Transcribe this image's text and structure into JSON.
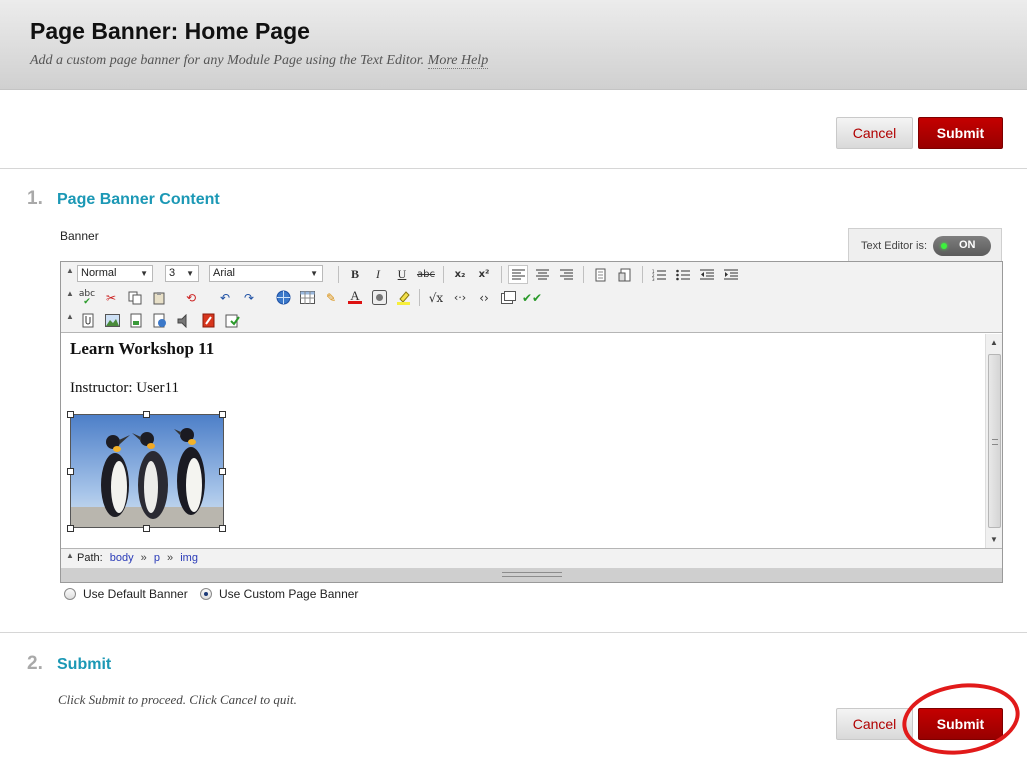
{
  "header": {
    "title": "Page Banner: Home Page",
    "subtitle": "Add a custom page banner for any Module Page using the Text Editor.",
    "more_help": "More Help"
  },
  "actions_top": {
    "cancel": "Cancel",
    "submit": "Submit"
  },
  "step1": {
    "number": "1.",
    "title": "Page Banner Content",
    "field_label": "Banner"
  },
  "text_editor": {
    "label": "Text Editor is:",
    "state": "ON"
  },
  "toolbar": {
    "paragraph_format": "Normal",
    "font_size": "3",
    "font_family": "Arial",
    "buttons": {
      "bold": "B",
      "italic": "I",
      "underline": "U",
      "strikethrough": "abc",
      "subscript": "x₂",
      "superscript": "x²",
      "spellcheck": "abc"
    }
  },
  "content": {
    "heading": "Learn Workshop 11",
    "instructor": "Instructor: User11",
    "image_alt": "penguins-image"
  },
  "path": {
    "label": "Path:",
    "items": [
      "body",
      "p",
      "img"
    ],
    "separator": "»"
  },
  "banner_options": [
    {
      "label": "Use Default Banner",
      "checked": false
    },
    {
      "label": "Use Custom Page Banner",
      "checked": true
    }
  ],
  "step2": {
    "number": "2.",
    "title": "Submit",
    "instructions": "Click Submit to proceed. Click Cancel to quit."
  },
  "actions_bottom": {
    "cancel": "Cancel",
    "submit": "Submit"
  },
  "colors": {
    "accent": "#1b98b5",
    "submit": "#b00000",
    "highlight": "#e11a1a"
  }
}
